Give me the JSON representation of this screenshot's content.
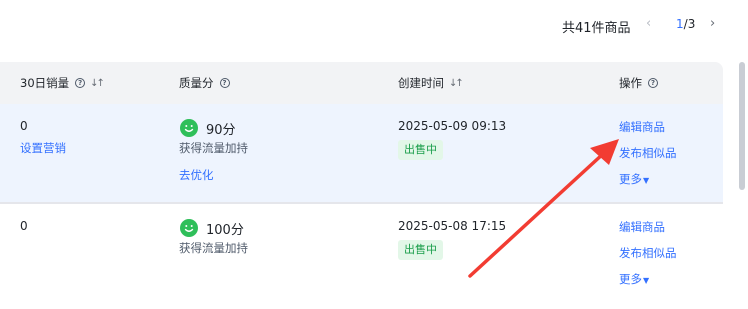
{
  "pagination": {
    "total": "共41件商品",
    "prev": "‹",
    "current": "1",
    "separator": "/",
    "pages": "3",
    "next": "›"
  },
  "headers": {
    "sales30": "30日销量",
    "quality": "质量分",
    "created": "创建时间",
    "actions": "操作"
  },
  "rows": [
    {
      "sales": "0",
      "sales_link": "设置营销",
      "score": "90分",
      "traffic": "获得流量加持",
      "optimize": "去优化",
      "created": "2025-05-09 09:13",
      "status": "出售中",
      "edit": "编辑商品",
      "publish_similar": "发布相似品",
      "more": "更多"
    },
    {
      "sales": "0",
      "score": "100分",
      "traffic": "获得流量加持",
      "created": "2025-05-08 17:15",
      "status": "出售中",
      "edit": "编辑商品",
      "publish_similar": "发布相似品",
      "more": "更多"
    }
  ],
  "colors": {
    "link": "#3370ff",
    "status_bg": "#e3f7e8",
    "status_text": "#1a9e4a",
    "highlight_row": "#eef4fe",
    "annotation_arrow": "#f23c32"
  }
}
